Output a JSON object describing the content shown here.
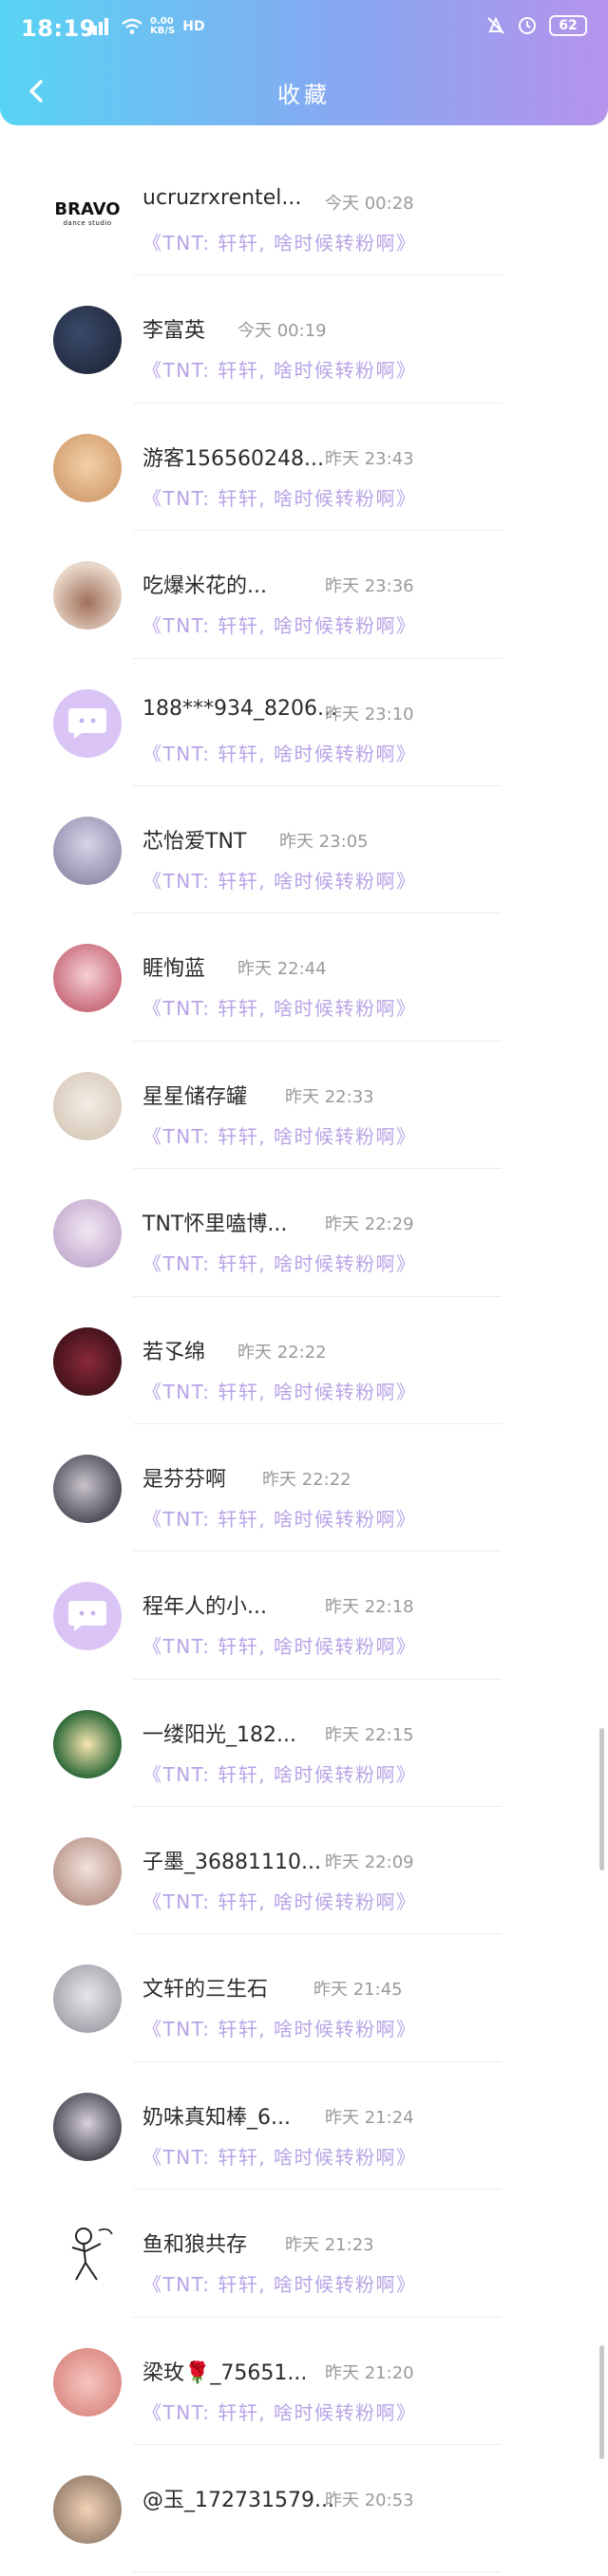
{
  "status_bar": {
    "time": "18:19",
    "network_speed": "0.00",
    "speed_unit": "KB/S",
    "network_type": "HD",
    "battery": "62"
  },
  "header": {
    "title": "收藏"
  },
  "items": [
    {
      "name": "ucruzrxrentel...",
      "time": "今天 00:28",
      "message": "《TNT: 轩轩, 啥时候转粉啊》",
      "avatar": "BRAVO",
      "avatar_sub": "dance studio"
    },
    {
      "name": "李富英",
      "time": "今天 00:19",
      "message": "《TNT: 轩轩, 啥时候转粉啊》"
    },
    {
      "name": "游客156560248...",
      "time": "昨天 23:43",
      "message": "《TNT: 轩轩, 啥时候转粉啊》"
    },
    {
      "name": "吃爆米花的...",
      "time": "昨天 23:36",
      "message": "《TNT: 轩轩, 啥时候转粉啊》"
    },
    {
      "name": "188***934_8206...",
      "time": "昨天 23:10",
      "message": "《TNT: 轩轩, 啥时候转粉啊》"
    },
    {
      "name": "芯怡爱TNT",
      "time": "昨天 23:05",
      "message": "《TNT: 轩轩, 啥时候转粉啊》"
    },
    {
      "name": "睚恂蓝",
      "time": "昨天 22:44",
      "message": "《TNT: 轩轩, 啥时候转粉啊》"
    },
    {
      "name": "星星储存罐",
      "time": "昨天 22:33",
      "message": "《TNT: 轩轩, 啥时候转粉啊》"
    },
    {
      "name": "TNT怀里嗑博...",
      "time": "昨天 22:29",
      "message": "《TNT: 轩轩, 啥时候转粉啊》"
    },
    {
      "name": "若孓绵",
      "time": "昨天 22:22",
      "message": "《TNT: 轩轩, 啥时候转粉啊》"
    },
    {
      "name": "是芬芬啊",
      "time": "昨天 22:22",
      "message": "《TNT: 轩轩, 啥时候转粉啊》"
    },
    {
      "name": "程年人的小...",
      "time": "昨天 22:18",
      "message": "《TNT: 轩轩, 啥时候转粉啊》"
    },
    {
      "name": "一缕阳光_182...",
      "time": "昨天 22:15",
      "message": "《TNT: 轩轩, 啥时候转粉啊》"
    },
    {
      "name": "子墨_36881110...",
      "time": "昨天 22:09",
      "message": "《TNT: 轩轩, 啥时候转粉啊》"
    },
    {
      "name": "文轩的三生石",
      "time": "昨天 21:45",
      "message": "《TNT: 轩轩, 啥时候转粉啊》"
    },
    {
      "name": "奶味真知棒_6...",
      "time": "昨天 21:24",
      "message": "《TNT: 轩轩, 啥时候转粉啊》"
    },
    {
      "name": "鱼和狼共存",
      "time": "昨天 21:23",
      "message": "《TNT: 轩轩, 啥时候转粉啊》"
    },
    {
      "name": "梁玫🌹_75651...",
      "time": "昨天 21:20",
      "message": "《TNT: 轩轩, 啥时候转粉啊》"
    },
    {
      "name": "@玉_172731579...",
      "time": "昨天 20:53",
      "message": ""
    }
  ],
  "colors": {
    "header_gradient_start": "#57d4f3",
    "header_gradient_end": "#b593ec",
    "message_color": "#b7a4e6",
    "time_color": "#9a9a9a"
  }
}
